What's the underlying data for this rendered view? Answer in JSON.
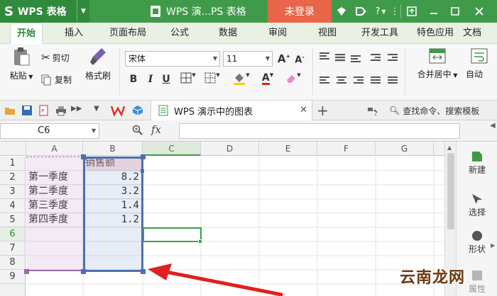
{
  "titlebar": {
    "app_name": "WPS 表格",
    "doc_title": "WPS 演...PS 表格",
    "login_label": "未登录",
    "help_label": "?"
  },
  "menu": {
    "tabs": [
      {
        "label": "开始",
        "active": true
      },
      {
        "label": "插入"
      },
      {
        "label": "页面布局"
      },
      {
        "label": "公式"
      },
      {
        "label": "数据"
      },
      {
        "label": "审阅"
      },
      {
        "label": "视图"
      },
      {
        "label": "开发工具"
      },
      {
        "label": "特色应用"
      },
      {
        "label": "文档"
      }
    ]
  },
  "ribbon": {
    "paste_label": "粘贴",
    "cut_label": "剪切",
    "copy_label": "复制",
    "format_painter_label": "格式刷",
    "font_name": "宋体",
    "font_size": "11",
    "bold": "B",
    "italic": "I",
    "underline": "U",
    "merge_center_label": "合并居中",
    "auto_wrap_label": "自动"
  },
  "quickbar": {
    "doc_tab_label": "WPS 演示中的图表",
    "search_label": "查找命令、搜索模板"
  },
  "formula_bar": {
    "cell_ref": "C6",
    "fx_label": "fx",
    "formula_value": ""
  },
  "sheet": {
    "columns": [
      "A",
      "B",
      "C",
      "D",
      "E",
      "F",
      "G"
    ],
    "rows": [
      "1",
      "2",
      "3",
      "4",
      "5",
      "6",
      "7",
      "8",
      "9"
    ],
    "cells": {
      "B1": "销售额",
      "A2": "第一季度",
      "B2": "8.2",
      "A3": "第二季度",
      "B3": "3.2",
      "A4": "第三季度",
      "B4": "1.4",
      "A5": "第四季度",
      "B5": "1.2"
    }
  },
  "taskpane": {
    "items": [
      {
        "label": "新建",
        "icon": "new-icon"
      },
      {
        "label": "选择",
        "icon": "select-icon"
      },
      {
        "label": "形状",
        "icon": "shape-icon"
      },
      {
        "label": "属性",
        "icon": "properties-icon"
      }
    ]
  },
  "watermark": "云南龙网",
  "colors": {
    "accent": "#3f9b4a",
    "login": "#e9664a",
    "range_blue": "#4d6fb0",
    "range_purple": "#9a6aa5",
    "arrow_red": "#e02020"
  }
}
